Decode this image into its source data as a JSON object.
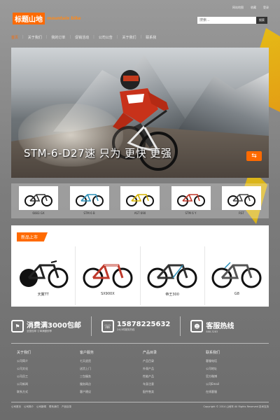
{
  "header": {
    "logo_cn": "标题山地",
    "logo_en": "mountain bike",
    "toplinks": [
      "网站地图",
      "收藏",
      "登录"
    ],
    "search_placeholder": "搜索...",
    "search_button": "搜索"
  },
  "nav": {
    "items": [
      "首页",
      "关于我们",
      "我的订单",
      "促销活动",
      "公司公告",
      "关于我们",
      "联系我"
    ]
  },
  "banner": {
    "slogan": "STM-6-D27速 只为 更快 更强",
    "next_icon": "arrow-right-icon"
  },
  "thumbs": [
    {
      "label": "6083 GX"
    },
    {
      "label": "STM 6 B"
    },
    {
      "label": "AST 690"
    },
    {
      "label": "STM 6 Y"
    },
    {
      "label": "RST"
    }
  ],
  "new_arrivals": {
    "tag": "新品上市",
    "products": [
      {
        "label": "天翼TT"
      },
      {
        "label": "SX900X"
      },
      {
        "label": "帝王300"
      },
      {
        "label": "G8"
      }
    ]
  },
  "service": {
    "promo_title": "消费满3000包邮",
    "promo_sub": "全国包邮  订单满额即享",
    "phone": "15878225632",
    "phone_sub": "24小时服务热线",
    "hotline_title": "客服热线",
    "hotline_sub": "888-3283"
  },
  "footer": {
    "columns": [
      {
        "title": "关于我们",
        "items": [
          "公司简介",
          "公司文化",
          "公司员工",
          "公司新闻",
          "联系方式"
        ]
      },
      {
        "title": "客户服务",
        "items": [
          "七天退货",
          "送货上门",
          "三包服务",
          "服务网点",
          "客户建议"
        ]
      },
      {
        "title": "产品目录",
        "items": [
          "产品目录",
          "外观产品",
          "性能产品",
          "车身注意",
          "配件售卖"
        ]
      },
      {
        "title": "联系我们",
        "items": [
          "客服电话",
          "公司地址",
          "官方微博",
          "公司Email",
          "在线客服"
        ]
      }
    ]
  },
  "bottom": {
    "links": [
      "公司首页",
      "公司简介",
      "公司新闻",
      "联系我们",
      "产品目录"
    ],
    "copyright": "Copyright © 2014 山地车 All Rights Reserved 技术支持"
  },
  "colors": {
    "accent": "#ff6a00",
    "background": "#8a8a8a"
  }
}
